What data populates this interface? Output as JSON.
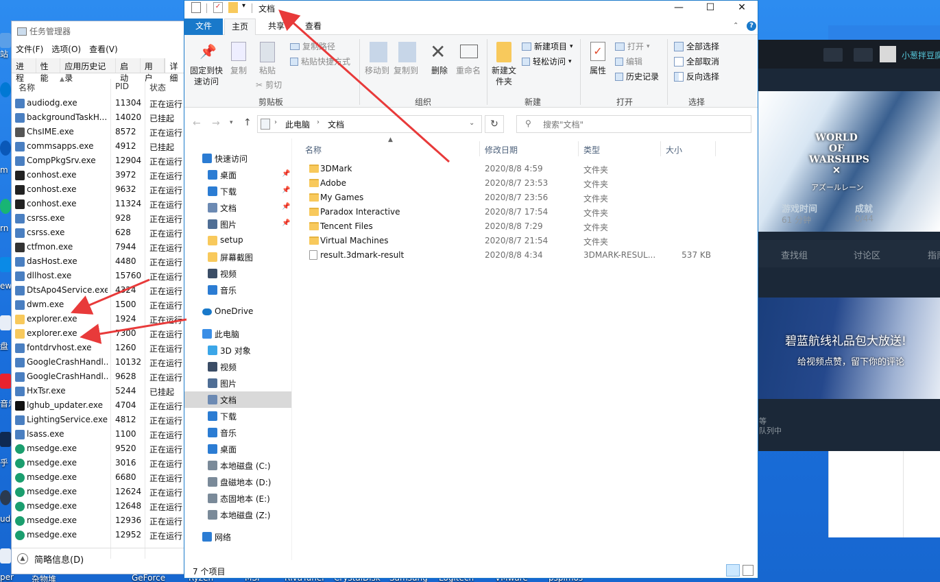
{
  "desktop": {
    "left_labels": [
      "站",
      "m",
      "rn",
      "ewe",
      "盘",
      "音乐",
      "乎",
      "udi",
      "per"
    ],
    "bottom_labels": [
      "杂物堆",
      "GeForce",
      "Ryzen",
      "MSI",
      "RivaTuner",
      "CrystalDisk",
      "Samsung",
      "Logitech",
      "VMware",
      "pspimos"
    ]
  },
  "steam": {
    "username": "小葱拌豆腐",
    "play_time_label": "游戏时间",
    "play_time_value": "61 分钟",
    "achievements_label": "成就",
    "achievements_value": "0/44",
    "nav_find_group": "查找组",
    "nav_discussions": "讨论区",
    "nav_guides": "指南",
    "banner_title": "碧蓝航线礼品包大放送!",
    "banner_subtitle": "给视频点赞，留下你的评论",
    "game_logo": "WORLD OF WARSHIPS",
    "collab_text": "アズールレーン",
    "queue_text_1": "等",
    "queue_text_2": "队列中"
  },
  "taskmgr": {
    "title": "任务管理器",
    "menu": [
      "文件(F)",
      "选项(O)",
      "查看(V)"
    ],
    "tabs": [
      "进程",
      "性能",
      "应用历史记录",
      "启动",
      "用户",
      "详细"
    ],
    "columns": {
      "name": "名称",
      "pid": "PID",
      "status": "状态"
    },
    "processes": [
      {
        "name": "audiodg.exe",
        "pid": "11304",
        "status": "正在运行",
        "icon": "app-icon",
        "color": "#4a7fc1"
      },
      {
        "name": "backgroundTaskH...",
        "pid": "14020",
        "status": "已挂起",
        "icon": "app-icon",
        "color": "#4a7fc1"
      },
      {
        "name": "ChsIME.exe",
        "pid": "8572",
        "status": "正在运行",
        "icon": "ime-icon",
        "color": "#555555"
      },
      {
        "name": "commsapps.exe",
        "pid": "4912",
        "status": "已挂起",
        "icon": "app-icon",
        "color": "#4a7fc1"
      },
      {
        "name": "CompPkgSrv.exe",
        "pid": "12904",
        "status": "正在运行",
        "icon": "app-icon",
        "color": "#4a7fc1"
      },
      {
        "name": "conhost.exe",
        "pid": "3972",
        "status": "正在运行",
        "icon": "console-icon",
        "color": "#222222"
      },
      {
        "name": "conhost.exe",
        "pid": "9632",
        "status": "正在运行",
        "icon": "console-icon",
        "color": "#222222"
      },
      {
        "name": "conhost.exe",
        "pid": "11324",
        "status": "正在运行",
        "icon": "console-icon",
        "color": "#222222"
      },
      {
        "name": "csrss.exe",
        "pid": "928",
        "status": "正在运行",
        "icon": "app-icon",
        "color": "#4a7fc1"
      },
      {
        "name": "csrss.exe",
        "pid": "628",
        "status": "正在运行",
        "icon": "app-icon",
        "color": "#4a7fc1"
      },
      {
        "name": "ctfmon.exe",
        "pid": "7944",
        "status": "正在运行",
        "icon": "pen-icon",
        "color": "#333333"
      },
      {
        "name": "dasHost.exe",
        "pid": "4480",
        "status": "正在运行",
        "icon": "app-icon",
        "color": "#4a7fc1"
      },
      {
        "name": "dllhost.exe",
        "pid": "15760",
        "status": "正在运行",
        "icon": "app-icon",
        "color": "#4a7fc1"
      },
      {
        "name": "DtsApo4Service.exe",
        "pid": "4324",
        "status": "正在运行",
        "icon": "app-icon",
        "color": "#4a7fc1"
      },
      {
        "name": "dwm.exe",
        "pid": "1500",
        "status": "正在运行",
        "icon": "app-icon",
        "color": "#4a7fc1"
      },
      {
        "name": "explorer.exe",
        "pid": "1924",
        "status": "正在运行",
        "icon": "folder-icon",
        "color": "#f8c95c"
      },
      {
        "name": "explorer.exe",
        "pid": "7300",
        "status": "正在运行",
        "icon": "folder-icon",
        "color": "#f8c95c"
      },
      {
        "name": "fontdrvhost.exe",
        "pid": "1260",
        "status": "正在运行",
        "icon": "app-icon",
        "color": "#4a7fc1"
      },
      {
        "name": "GoogleCrashHandl...",
        "pid": "10132",
        "status": "正在运行",
        "icon": "app-icon",
        "color": "#4a7fc1"
      },
      {
        "name": "GoogleCrashHandl...",
        "pid": "9628",
        "status": "正在运行",
        "icon": "app-icon",
        "color": "#4a7fc1"
      },
      {
        "name": "HxTsr.exe",
        "pid": "5244",
        "status": "已挂起",
        "icon": "app-icon",
        "color": "#4a7fc1"
      },
      {
        "name": "lghub_updater.exe",
        "pid": "4704",
        "status": "正在运行",
        "icon": "logitech-icon",
        "color": "#111111"
      },
      {
        "name": "LightingService.exe",
        "pid": "4812",
        "status": "正在运行",
        "icon": "app-icon",
        "color": "#4a7fc1"
      },
      {
        "name": "lsass.exe",
        "pid": "1100",
        "status": "正在运行",
        "icon": "app-icon",
        "color": "#4a7fc1"
      },
      {
        "name": "msedge.exe",
        "pid": "9520",
        "status": "正在运行",
        "icon": "edge-icon",
        "color": "#1b9e6e"
      },
      {
        "name": "msedge.exe",
        "pid": "3016",
        "status": "正在运行",
        "icon": "edge-icon",
        "color": "#1b9e6e"
      },
      {
        "name": "msedge.exe",
        "pid": "6680",
        "status": "正在运行",
        "icon": "edge-icon",
        "color": "#1b9e6e"
      },
      {
        "name": "msedge.exe",
        "pid": "12624",
        "status": "正在运行",
        "icon": "edge-icon",
        "color": "#1b9e6e"
      },
      {
        "name": "msedge.exe",
        "pid": "12648",
        "status": "正在运行",
        "icon": "edge-icon",
        "color": "#1b9e6e"
      },
      {
        "name": "msedge.exe",
        "pid": "12936",
        "status": "正在运行",
        "icon": "edge-icon",
        "color": "#1b9e6e"
      },
      {
        "name": "msedge.exe",
        "pid": "12952",
        "status": "正在运行",
        "icon": "edge-icon",
        "color": "#1b9e6e"
      }
    ],
    "footer_label": "简略信息(D)"
  },
  "explorer": {
    "title": "文档",
    "ribbon_tabs": [
      "文件",
      "主页",
      "共享",
      "查看"
    ],
    "clipboard": {
      "pin": "固定到快速访问",
      "copy": "复制",
      "paste": "粘贴",
      "copy_path": "复制路径",
      "paste_shortcut": "粘贴快捷方式",
      "cut": "剪切",
      "group": "剪贴板"
    },
    "organize": {
      "move_to": "移动到",
      "copy_to": "复制到",
      "delete": "删除",
      "rename": "重命名",
      "group": "组织"
    },
    "new": {
      "new_folder": "新建文件夹",
      "new_item": "新建项目",
      "easy_access": "轻松访问",
      "group": "新建"
    },
    "open": {
      "properties": "属性",
      "open": "打开",
      "edit": "编辑",
      "history": "历史记录",
      "group": "打开"
    },
    "select": {
      "select_all": "全部选择",
      "select_none": "全部取消",
      "invert": "反向选择",
      "group": "选择"
    },
    "breadcrumb": [
      "此电脑",
      "文档"
    ],
    "search_placeholder": "搜索\"文档\"",
    "nav": [
      {
        "label": "快速访问",
        "icon": "star-icon",
        "color": "#2b7cd3",
        "indent": 26,
        "pin": false
      },
      {
        "label": "桌面",
        "icon": "desktop-icon",
        "color": "#2b7cd3",
        "indent": 34,
        "pin": true
      },
      {
        "label": "下载",
        "icon": "download-icon",
        "color": "#2b7cd3",
        "indent": 34,
        "pin": true
      },
      {
        "label": "文档",
        "icon": "document-icon",
        "color": "#6c8ab3",
        "indent": 34,
        "pin": true
      },
      {
        "label": "图片",
        "icon": "picture-icon",
        "color": "#4f6e95",
        "indent": 34,
        "pin": true
      },
      {
        "label": "setup",
        "icon": "folder-icon",
        "color": "#f8c95c",
        "indent": 34,
        "pin": false
      },
      {
        "label": "屏幕截图",
        "icon": "folder-icon",
        "color": "#f8c95c",
        "indent": 34,
        "pin": false
      },
      {
        "label": "视频",
        "icon": "video-icon",
        "color": "#3b4d66",
        "indent": 34,
        "pin": false
      },
      {
        "label": "音乐",
        "icon": "music-icon",
        "color": "#2b7cd3",
        "indent": 34,
        "pin": false
      },
      {
        "label": "OneDrive",
        "icon": "cloud-icon",
        "color": "#1979ca",
        "indent": 26,
        "pin": false
      },
      {
        "label": "此电脑",
        "icon": "computer-icon",
        "color": "#3a8ee6",
        "indent": 26,
        "pin": false
      },
      {
        "label": "3D 对象",
        "icon": "cube-icon",
        "color": "#3ba6e8",
        "indent": 34,
        "pin": false
      },
      {
        "label": "视频",
        "icon": "video-icon",
        "color": "#3b4d66",
        "indent": 34,
        "pin": false
      },
      {
        "label": "图片",
        "icon": "picture-icon",
        "color": "#4f6e95",
        "indent": 34,
        "pin": false
      },
      {
        "label": "文档",
        "icon": "document-icon",
        "color": "#6c8ab3",
        "indent": 34,
        "pin": false
      },
      {
        "label": "下载",
        "icon": "download-icon",
        "color": "#2b7cd3",
        "indent": 34,
        "pin": false
      },
      {
        "label": "音乐",
        "icon": "music-icon",
        "color": "#2b7cd3",
        "indent": 34,
        "pin": false
      },
      {
        "label": "桌面",
        "icon": "desktop-icon",
        "color": "#2b7cd3",
        "indent": 34,
        "pin": false
      },
      {
        "label": "本地磁盘 (C:)",
        "icon": "drive-icon",
        "color": "#7a8a99",
        "indent": 34,
        "pin": false
      },
      {
        "label": "盘磁地本 (D:)",
        "icon": "drive-icon",
        "color": "#7a8a99",
        "indent": 34,
        "pin": false
      },
      {
        "label": "态固地本 (E:)",
        "icon": "drive-icon",
        "color": "#7a8a99",
        "indent": 34,
        "pin": false
      },
      {
        "label": "本地磁盘 (Z:)",
        "icon": "drive-icon",
        "color": "#7a8a99",
        "indent": 34,
        "pin": false
      },
      {
        "label": "网络",
        "icon": "network-icon",
        "color": "#2b7cd3",
        "indent": 26,
        "pin": false
      }
    ],
    "columns": {
      "name": "名称",
      "date": "修改日期",
      "type": "类型",
      "size": "大小"
    },
    "files": [
      {
        "name": "3DMark",
        "date": "2020/8/8 4:59",
        "type": "文件夹",
        "size": "",
        "kind": "folder"
      },
      {
        "name": "Adobe",
        "date": "2020/8/7 23:53",
        "type": "文件夹",
        "size": "",
        "kind": "folder"
      },
      {
        "name": "My Games",
        "date": "2020/8/7 23:56",
        "type": "文件夹",
        "size": "",
        "kind": "folder"
      },
      {
        "name": "Paradox Interactive",
        "date": "2020/8/7 17:54",
        "type": "文件夹",
        "size": "",
        "kind": "folder"
      },
      {
        "name": "Tencent Files",
        "date": "2020/8/8 7:29",
        "type": "文件夹",
        "size": "",
        "kind": "folder"
      },
      {
        "name": "Virtual Machines",
        "date": "2020/8/7 21:54",
        "type": "文件夹",
        "size": "",
        "kind": "folder"
      },
      {
        "name": "result.3dmark-result",
        "date": "2020/8/8 4:34",
        "type": "3DMARK-RESUL...",
        "size": "537 KB",
        "kind": "file"
      }
    ],
    "status": "7 个项目"
  },
  "colors": {
    "accent": "#1979ca",
    "arrow": "#e83a3a"
  }
}
